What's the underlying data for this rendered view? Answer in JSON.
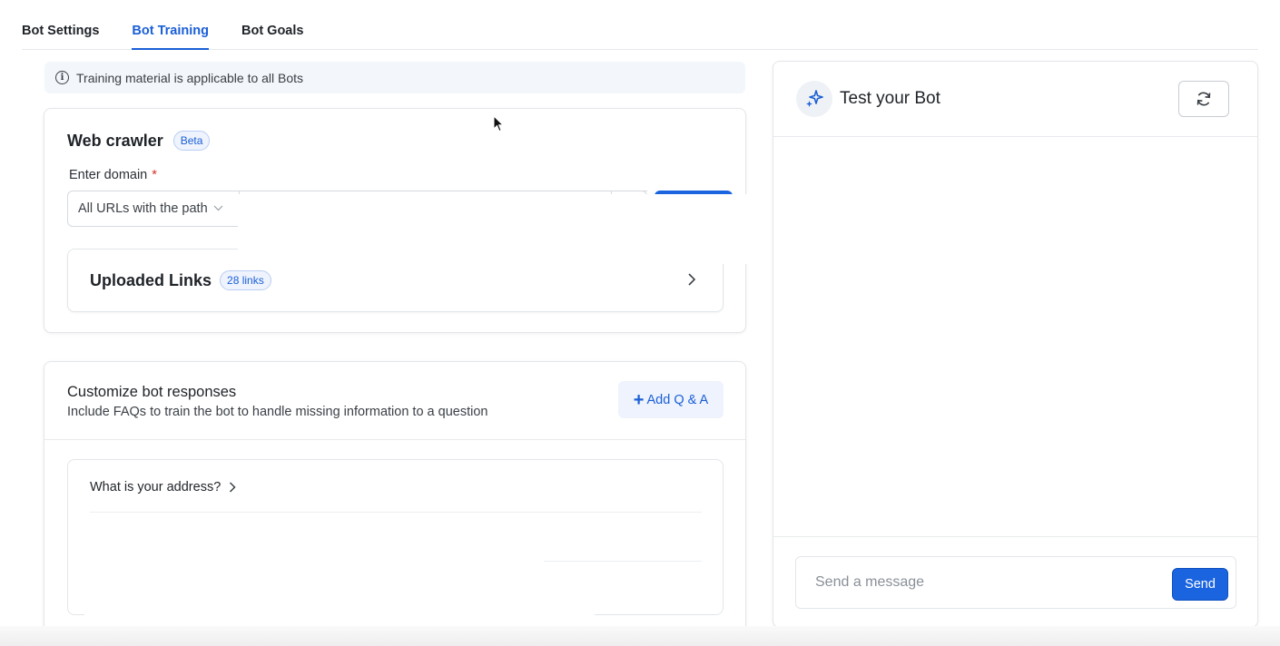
{
  "tabs": [
    {
      "label": "Bot Settings",
      "active": false
    },
    {
      "label": "Bot Training",
      "active": true
    },
    {
      "label": "Bot Goals",
      "active": false
    }
  ],
  "info_banner": {
    "text": "Training material is applicable to all Bots"
  },
  "crawler": {
    "title": "Web crawler",
    "badge": "Beta",
    "domain_label": "Enter domain",
    "required_mark": "*",
    "scope_select": "All URLs with the path",
    "links_title": "Uploaded Links",
    "links_count": "28 links"
  },
  "customize": {
    "title": "Customize bot responses",
    "subtitle": "Include FAQs to train the bot to handle missing information to a question",
    "add_button": "Add Q & A",
    "questions": [
      "What is your address?"
    ]
  },
  "test": {
    "title": "Test your Bot",
    "message_placeholder": "Send a message",
    "send_label": "Send"
  },
  "colors": {
    "accent": "#1a5fd6",
    "primary_button": "#1a64e0",
    "badge_bg": "#eef3fd"
  }
}
